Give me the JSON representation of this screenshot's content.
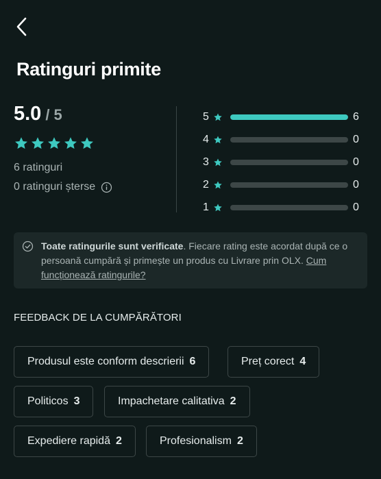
{
  "title": "Ratinguri primite",
  "summary": {
    "score": "5.0",
    "max": "/ 5",
    "stars": 5,
    "ratings_count": "6 ratinguri",
    "deleted_count": "0 ratinguri șterse"
  },
  "distribution": [
    {
      "stars": "5",
      "count": "6",
      "fraction": 1.0
    },
    {
      "stars": "4",
      "count": "0",
      "fraction": 0
    },
    {
      "stars": "3",
      "count": "0",
      "fraction": 0
    },
    {
      "stars": "2",
      "count": "0",
      "fraction": 0
    },
    {
      "stars": "1",
      "count": "0",
      "fraction": 0
    }
  ],
  "notice": {
    "bold": "Toate ratingurile sunt verificate",
    "text": ". Fiecare rating este acordat după ce o persoană cumpără și primește un produs cu Livrare prin OLX. ",
    "link": "Cum funcționează ratingurile?"
  },
  "feedback": {
    "heading": "FEEDBACK DE LA CUMPĂRĂTORI",
    "chips": [
      {
        "label": "Produsul este conform descrierii",
        "count": "6"
      },
      {
        "label": "Preț corect",
        "count": "4"
      },
      {
        "label": "Politicos",
        "count": "3"
      },
      {
        "label": "Impachetare calitativa",
        "count": "2"
      },
      {
        "label": "Expediere rapidă",
        "count": "2"
      },
      {
        "label": "Profesionalism",
        "count": "2"
      }
    ]
  },
  "colors": {
    "accent": "#3ec9c0",
    "background": "#0f1a1a"
  },
  "icons": {
    "back": "chevron-left-icon",
    "star": "star-icon",
    "info": "info-icon",
    "check": "check-circle-icon"
  }
}
